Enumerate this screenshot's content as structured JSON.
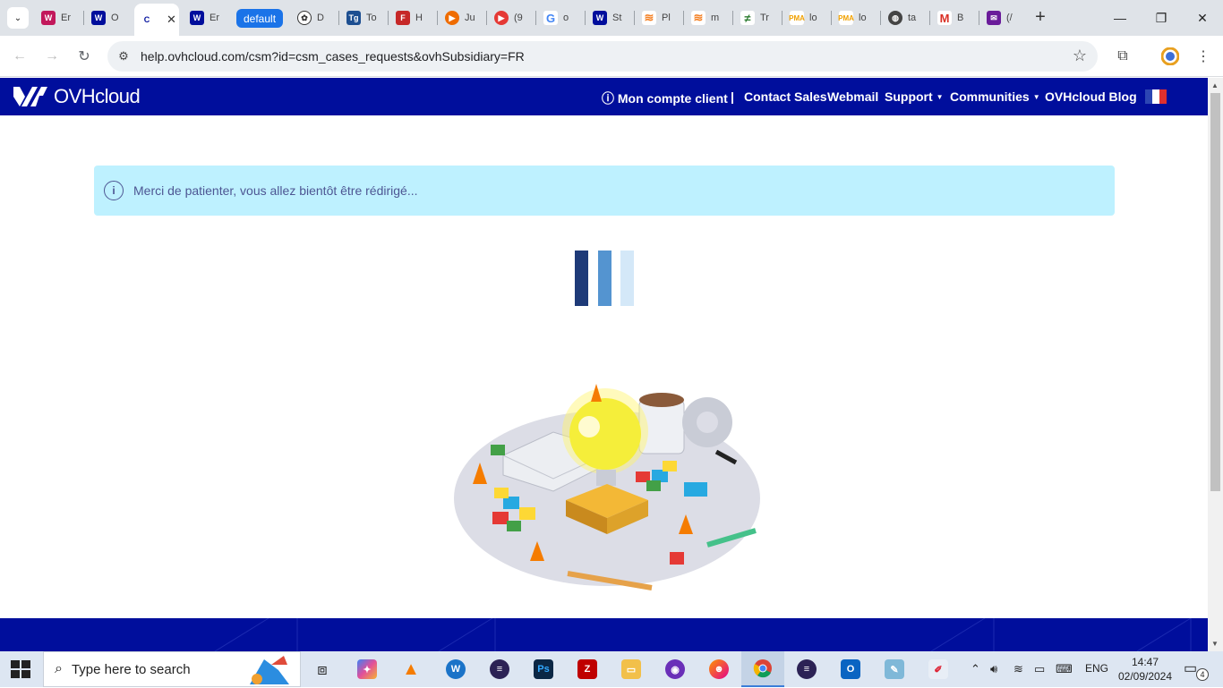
{
  "browser": {
    "tabs": [
      {
        "title": "Er",
        "icon": "wamp-icon",
        "color": "#c2185b"
      },
      {
        "title": "O",
        "icon": "ovh-icon",
        "color": "#000e9c"
      },
      {
        "title": "C",
        "icon": "ovh-icon",
        "color": "#000e9c",
        "active": true
      },
      {
        "title": "Er",
        "icon": "ovh-icon",
        "color": "#000e9c"
      },
      {
        "title": "default",
        "icon": "none",
        "pill": true
      },
      {
        "title": "D",
        "icon": "openai-icon",
        "color": "#333333"
      },
      {
        "title": "To",
        "icon": "tg-icon",
        "color": "#1d4f91"
      },
      {
        "title": "H",
        "icon": "fa-icon",
        "color": "#c62828"
      },
      {
        "title": "Ju",
        "icon": "play-icon",
        "color": "#ef6c00"
      },
      {
        "title": "(9",
        "icon": "youtube-icon",
        "color": "#e53935"
      },
      {
        "title": "o",
        "icon": "google-icon",
        "color": "#4285f4"
      },
      {
        "title": "St",
        "icon": "ovh-icon",
        "color": "#000e9c"
      },
      {
        "title": "Pl",
        "icon": "stack-icon",
        "color": "#f48024"
      },
      {
        "title": "m",
        "icon": "stack-icon",
        "color": "#f48024"
      },
      {
        "title": "Tr",
        "icon": "tr-icon",
        "color": "#2e7d32"
      },
      {
        "title": "lo",
        "icon": "pma-icon",
        "color": "#f0a000"
      },
      {
        "title": "lo",
        "icon": "pma-icon",
        "color": "#f0a000"
      },
      {
        "title": "ta",
        "icon": "globe-icon",
        "color": "#444444"
      },
      {
        "title": "B",
        "icon": "gmail-icon",
        "color": "#d93025"
      },
      {
        "title": "(/",
        "icon": "mail-icon",
        "color": "#6a1b9a"
      }
    ],
    "close_glyph": "✕",
    "newtab_glyph": "+",
    "url": "help.ovhcloud.com/csm?id=csm_cases_requests&ovhSubsidiary=FR"
  },
  "header": {
    "logo_text": "OVHcloud",
    "nav": {
      "account": "Mon compte client",
      "separator": "|",
      "contact": "Contact Sales",
      "webmail": "Webmail",
      "support": "Support",
      "communities": "Communities",
      "blog": "OVHcloud Blog"
    },
    "brand_color": "#000e9c"
  },
  "main": {
    "alert_message": "Merci de patienter, vous allez bientôt être rédirigé...",
    "alert_icon_glyph": "i",
    "loader_colors": [
      "#1e3a78",
      "#5494d0",
      "#d4e8f8"
    ]
  },
  "taskbar": {
    "search_placeholder": "Type here to search",
    "language": "ENG",
    "time": "14:47",
    "date": "02/09/2024",
    "notifications": "4"
  }
}
